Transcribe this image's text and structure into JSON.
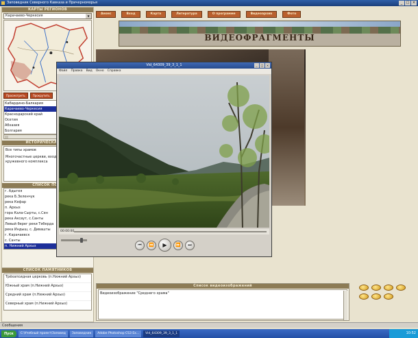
{
  "window": {
    "title": "Заповедник Северного Кавказа и Причерноморья"
  },
  "left": {
    "maps_header": "КАРТЫ РЕГИОНОВ",
    "region_select": "Карачаево-Черкесия",
    "map_btn_1": "Просмотреть",
    "map_btn_2": "Прокрутить",
    "regions": [
      "Кабардино-Балкария",
      "Карачаево-Черкесия",
      "Краснодарский край",
      "Осетия",
      "Абхазия",
      "Болгария"
    ],
    "history_header": "ИСТОРИЧЕСКАЯ ПРЕ",
    "history_items": [
      "Все типы храмов",
      "Многочастные церкви, входящие в состав кружевного комплекса"
    ],
    "list_header": "СПИСОК ПОСЕ",
    "places": [
      "г. Адыгея",
      "река Б.Зеленчук",
      "река Кефар",
      "п. Архыз",
      "гора Кала-Сырты, с.Сен",
      "река Аксаут, с.Санты",
      "Левый берег реки Теберда",
      "река Индыш, с. Дивашты",
      "г. Карачаевск",
      "с. Санты",
      "п. Нижний Архыз"
    ],
    "selected_place": "п. Нижний Архыз"
  },
  "nav": {
    "items": [
      "Анонс",
      "Вход",
      "Карта",
      "Литература",
      "О программе",
      "Видеоархив",
      "Фото"
    ]
  },
  "banner": {
    "title": "ВИДЕОФРАГМЕНТЫ"
  },
  "player": {
    "title": "Vid_64309_39_3_1_1",
    "menu": [
      "Файл",
      "Правка",
      "Вид",
      "Окно",
      "Справка"
    ],
    "time": "00:00:00"
  },
  "monuments": {
    "header": "СПИСОК ПАМЯТНИКОВ",
    "items": [
      "Трёхапсидная церковь (п.Нижний Архыз)",
      "Южный храм (п.Нижний Архыз)",
      "Средний храм (п.Нижний Архыз)",
      "Северный храм (п.Нижний Архыз)"
    ]
  },
  "captions": {
    "header": "Список видеоизображений",
    "item": "Видеоизображение \"Среднего храма\""
  },
  "status": {
    "text": "Сообщения"
  },
  "taskbar": {
    "start": "Пуск",
    "tasks": [
      "C:\\Учебный проект\\Заповед",
      "Заповедник",
      "Adobe Photoshop CS3 Ex...",
      "Vid_64309_39_3_1_1"
    ],
    "clock": "10:52"
  }
}
